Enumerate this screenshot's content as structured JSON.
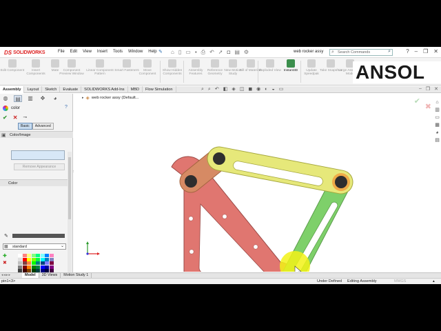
{
  "app": {
    "brand": "SOLIDWORKS",
    "brand_mark": "DS",
    "document_title": "web rocker assy"
  },
  "menu": [
    "File",
    "Edit",
    "View",
    "Insert",
    "Tools",
    "Window",
    "Help"
  ],
  "search": {
    "placeholder": "Search Commands"
  },
  "command_manager": [
    "Edit Component",
    "Insert Components",
    "Mate",
    "Component Preview Window",
    "Linear Component Pattern",
    "Smart Fasteners",
    "Move Component",
    "Show Hidden Components",
    "Assembly Features",
    "Reference Geometry",
    "New Motion Study",
    "Bill of Materials",
    "Exploded View",
    "Instant3D",
    "Update Speedpak",
    "Take Snapshot",
    "Large Assembly Mode"
  ],
  "active_command": "Instant3D",
  "watermark": "ANSOL",
  "tabs": [
    "Assembly",
    "Layout",
    "Sketch",
    "Evaluate",
    "SOLIDWORKS Add-Ins",
    "MBD",
    "Flow Simulation"
  ],
  "active_tab": "Assembly",
  "property_manager": {
    "title": "color",
    "modes": [
      "Basic",
      "Advanced"
    ],
    "active_mode": "Basic",
    "section_color_image": "Color/Image",
    "remove_appearance": "Remove Appearance",
    "section_color": "Color",
    "palette_select": "standard",
    "rgb_value": "64"
  },
  "palette_colors": [
    "#ffffff",
    "#ff8080",
    "#ffff80",
    "#80ff80",
    "#00ff80",
    "#80ffff",
    "#0080ff",
    "#ff80c0",
    "#e0e0e0",
    "#ff0000",
    "#ffff00",
    "#80ff00",
    "#00ff40",
    "#00ffff",
    "#0080c0",
    "#8080c0",
    "#c0c0c0",
    "#804040",
    "#ff8040",
    "#00ff00",
    "#008080",
    "#004080",
    "#8080ff",
    "#800040",
    "#808080",
    "#800000",
    "#ff8000",
    "#008000",
    "#008040",
    "#0000ff",
    "#0000a0",
    "#800080",
    "#404040",
    "#400000",
    "#804000",
    "#004000",
    "#004040",
    "#000080",
    "#000040",
    "#400040"
  ],
  "tree": {
    "root": "web rocker assy  (Default..."
  },
  "bottom_tabs": [
    "Model",
    "3D Views",
    "Motion Study 1"
  ],
  "active_bottom_tab": "Model",
  "status": {
    "left": "pin1<3>",
    "definition": "Under Defined",
    "mode": "Editing Assembly",
    "units": "MMGS"
  },
  "model_colors": {
    "base_plate": "#e07670",
    "top_link": "#e6e87a",
    "short_link": "#d68a64",
    "long_link": "#7ed06a",
    "cursor_highlight": "#f2f218"
  }
}
